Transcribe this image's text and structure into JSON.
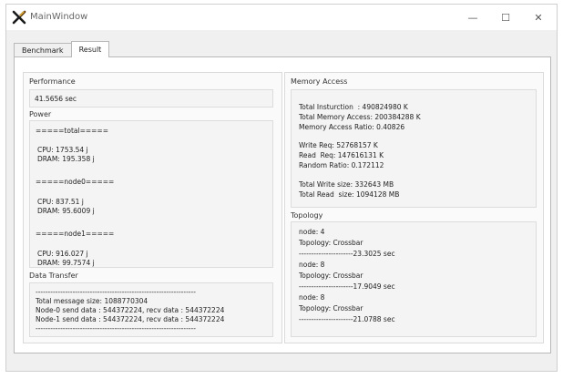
{
  "window": {
    "title": "MainWindow",
    "controls": {
      "minimize": "—",
      "maximize": "☐",
      "close": "✕"
    }
  },
  "tabs": [
    {
      "label": "Benchmark",
      "active": false
    },
    {
      "label": "Result",
      "active": true
    }
  ],
  "performance": {
    "label": "Performance",
    "value": "41.5656 sec"
  },
  "power": {
    "label": "Power",
    "lines": [
      "=====total=====",
      "CPU: 1753.54 j",
      "DRAM: 195.358 j",
      "=====node0=====",
      "CPU: 837.51 j",
      "DRAM: 95.6009 j",
      "=====node1=====",
      "CPU: 916.027 j",
      "DRAM: 99.7574 j"
    ]
  },
  "data_transfer": {
    "label": "Data Transfer",
    "lines": [
      "-----------------------------------------------------------------",
      "Total message size: 1088770304",
      "Node-0 send data : 544372224, recv data : 544372224",
      "Node-1 send data : 544372224, recv data : 544372224",
      "-----------------------------------------------------------------"
    ]
  },
  "memory_access": {
    "label": "Memory Access",
    "lines": [
      "Total Insturction  : 490824980 K",
      "Total Memory Access: 200384288 K",
      "Memory Access Ratio: 0.40826",
      "Write Req: 52768157 K",
      "Read  Req: 147616131 K",
      "Random Ratio: 0.172112",
      "Total Write size: 332643 MB",
      "Total Read  size: 1094128 MB"
    ]
  },
  "topology": {
    "label": "Topology",
    "lines": [
      "node: 4",
      "Topology: Crossbar",
      "----------------------23.3025 sec",
      "node: 8",
      "Topology: Crossbar",
      "----------------------17.9049 sec",
      "node: 8",
      "Topology: Crossbar",
      "----------------------21.0788 sec"
    ]
  },
  "colors": {
    "icon_primary": "#1a1a1a",
    "icon_accent": "#e0a020"
  }
}
